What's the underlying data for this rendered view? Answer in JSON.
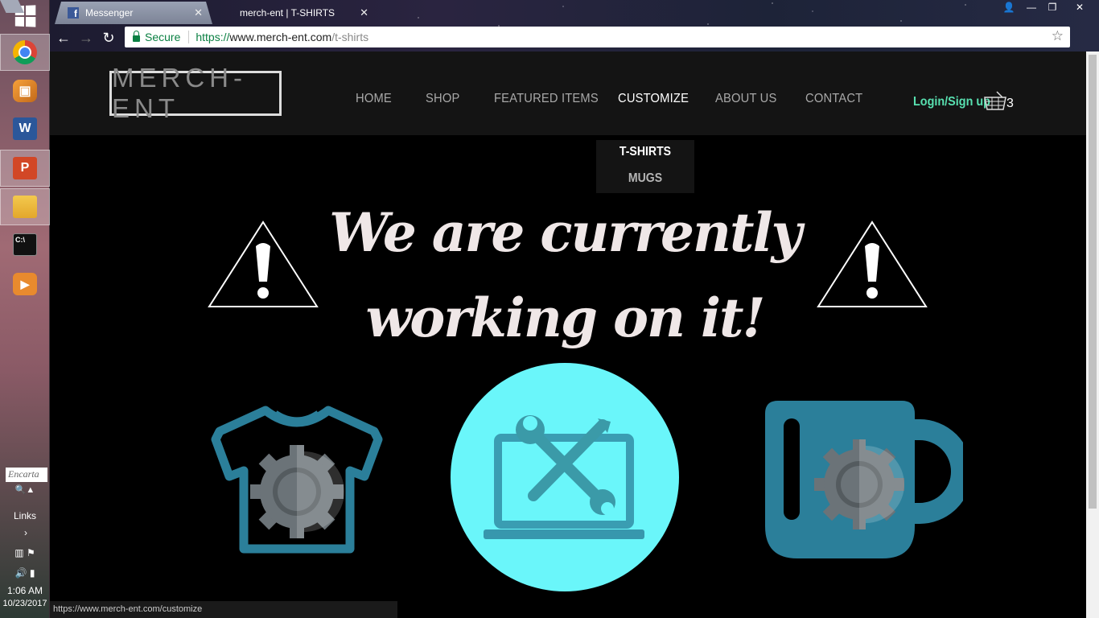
{
  "tabs": [
    {
      "title": "Messenger"
    },
    {
      "title": "merch-ent | T-SHIRTS"
    }
  ],
  "address_bar": {
    "secure_label": "Secure",
    "url_scheme": "https://",
    "url_host": "www.merch-ent.com",
    "url_path": "/t-shirts"
  },
  "taskbar": {
    "encarta_placeholder": "Encarta",
    "links_label": "Links",
    "time": "1:06 AM",
    "date": "10/23/2017"
  },
  "site": {
    "logo": "MERCH-ENT",
    "nav": [
      "HOME",
      "SHOP",
      "FEATURED ITEMS",
      "CUSTOMIZE",
      "ABOUT US",
      "CONTACT"
    ],
    "login": "Login/Sign up",
    "cart_count": "3",
    "dropdown": [
      "T-SHIRTS",
      "MUGS"
    ],
    "headline_line1": "We are currently",
    "headline_line2": "working on it!"
  },
  "status_url": "https://www.merch-ent.com/customize",
  "colors": {
    "accent_green": "#58e0b0",
    "icon_teal": "#2b7f9a",
    "circle_cyan": "#6af6fa"
  }
}
